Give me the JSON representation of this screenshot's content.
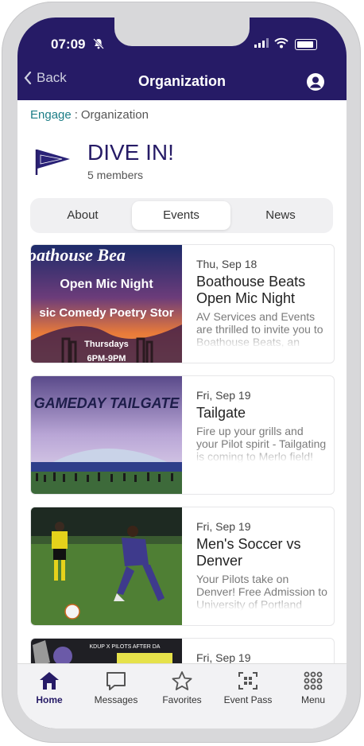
{
  "status_bar": {
    "time": "07:09"
  },
  "nav": {
    "back_label": "Back",
    "title": "Organization"
  },
  "breadcrumb": {
    "root": "Engage",
    "separator": ":",
    "current": "Organization"
  },
  "org": {
    "name": "DIVE IN!",
    "members": "5 members"
  },
  "tabs": [
    {
      "label": "About",
      "active": false
    },
    {
      "label": "Events",
      "active": true
    },
    {
      "label": "News",
      "active": false
    }
  ],
  "events": [
    {
      "date": "Thu, Sep 18",
      "title": "Boathouse Beats Open Mic Night",
      "description": "AV Services and Events are thrilled to invite you to Boathouse Beats, an",
      "poster_lines": [
        "oathouse Bea",
        "Open Mic Night",
        "sic Comedy Poetry Stor",
        "Thursdays",
        "6PM-9PM"
      ]
    },
    {
      "date": "Fri, Sep 19",
      "title": "Tailgate",
      "description": "Fire up your grills and your Pilot spirit - Tailgating is coming to Merlo field! Grab your",
      "poster_lines": [
        "GAMEDAY TAILGATE"
      ]
    },
    {
      "date": "Fri, Sep 19",
      "title": "Men's Soccer vs Denver",
      "description": "Your Pilots take on Denver! Free Admission to University of Portland",
      "poster_lines": []
    },
    {
      "date": "Fri, Sep 19",
      "title": "",
      "description": "",
      "poster_lines": [
        "KDUP X PILOTS AFTER DA"
      ]
    }
  ],
  "tabbar": [
    {
      "label": "Home",
      "icon": "home-icon",
      "active": true
    },
    {
      "label": "Messages",
      "icon": "message-icon",
      "active": false
    },
    {
      "label": "Favorites",
      "icon": "star-icon",
      "active": false
    },
    {
      "label": "Event Pass",
      "icon": "qr-code-icon",
      "active": false
    },
    {
      "label": "Menu",
      "icon": "grid-menu-icon",
      "active": false
    }
  ],
  "colors": {
    "brand": "#261b66",
    "link": "#1b7d86"
  }
}
